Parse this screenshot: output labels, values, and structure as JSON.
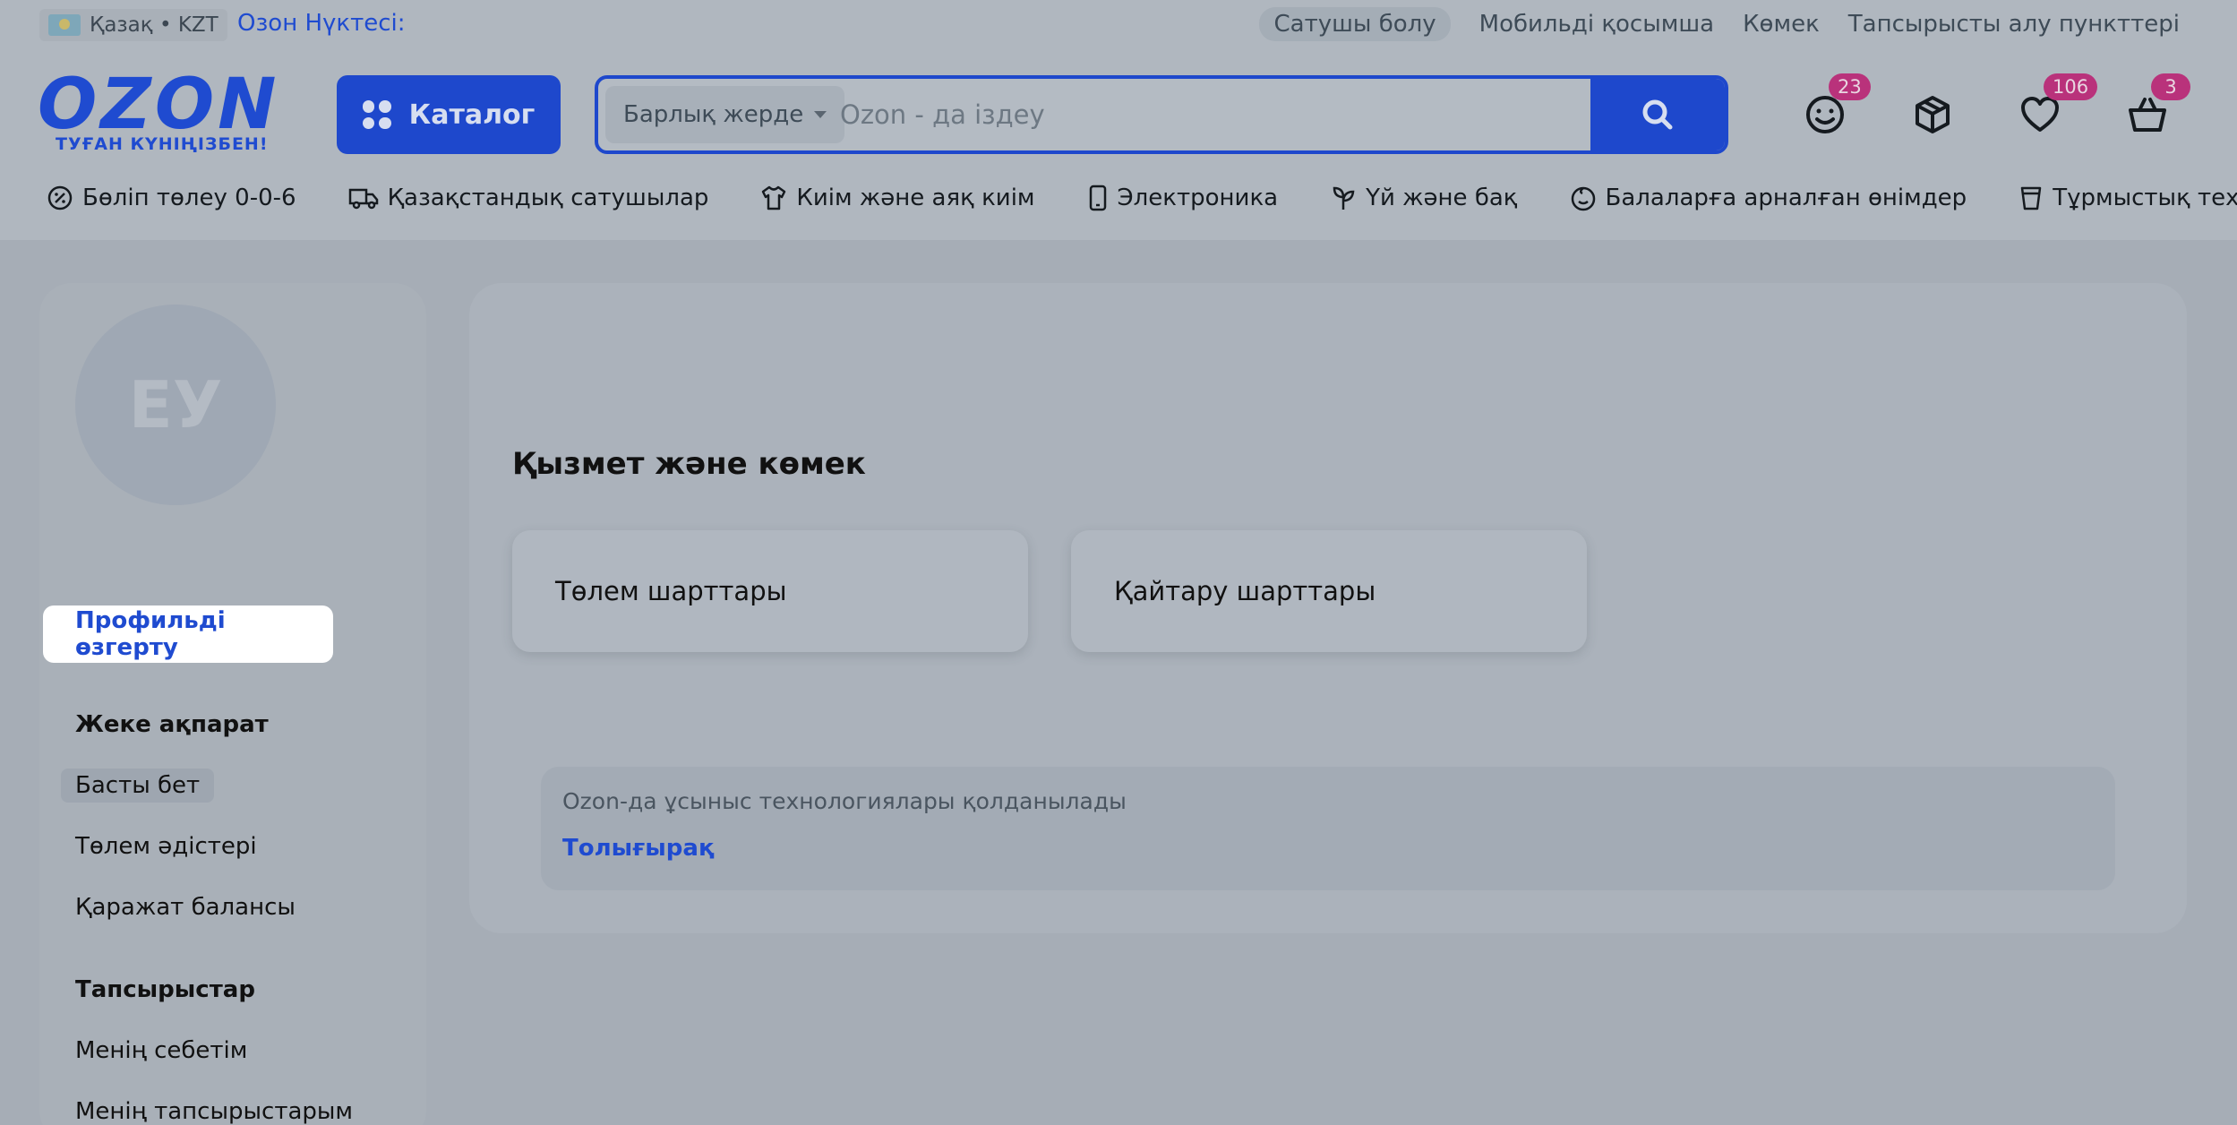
{
  "topbar": {
    "language": "Қазақ • KZT",
    "ozon_point": "Озон Нүктесі:",
    "links": [
      "Сатушы болу",
      "Мобильді қосымша",
      "Көмек",
      "Тапсырысты алу пункттері"
    ]
  },
  "logo": {
    "text": "OZON",
    "tagline": "ТУҒАН КҮНІҢІЗБЕН!"
  },
  "catalog": {
    "label": "Каталог"
  },
  "search": {
    "scope": "Барлық жерде",
    "placeholder": "Ozon - да іздеу"
  },
  "header_icons": [
    {
      "icon": "profile-face-icon",
      "badge": "23"
    },
    {
      "icon": "box-icon",
      "badge": ""
    },
    {
      "icon": "heart-icon",
      "badge": "106"
    },
    {
      "icon": "basket-icon",
      "badge": "3"
    }
  ],
  "categories": [
    "Бөліп төлеу 0-0-6",
    "Қазақстандық сатушылар",
    "Киім және аяқ киім",
    "Электроника",
    "Үй және бақ",
    "Балаларға арналған өнімдер",
    "Тұрмыстық техника"
  ],
  "sidebar": {
    "avatar_initials": "ЕУ",
    "edit_profile": "Профильді өзгерту",
    "section_personal": "Жеке ақпарат",
    "personal_items": [
      "Басты бет",
      "Төлем әдістері",
      "Қаражат балансы"
    ],
    "section_orders": "Тапсырыстар",
    "order_items": [
      "Менің себетім",
      "Менің тапсырыстарым"
    ]
  },
  "main": {
    "title": "Қызмет және көмек",
    "cards": [
      "Төлем шарттары",
      "Қайтару шарттары"
    ],
    "info_text": "Ozon-да ұсыныс технологиялары қолданылады",
    "info_link": "Толығырақ"
  },
  "colors": {
    "accent": "#1e48cc",
    "badge": "#b9327b",
    "overlay_bg": "#a6adb6"
  }
}
